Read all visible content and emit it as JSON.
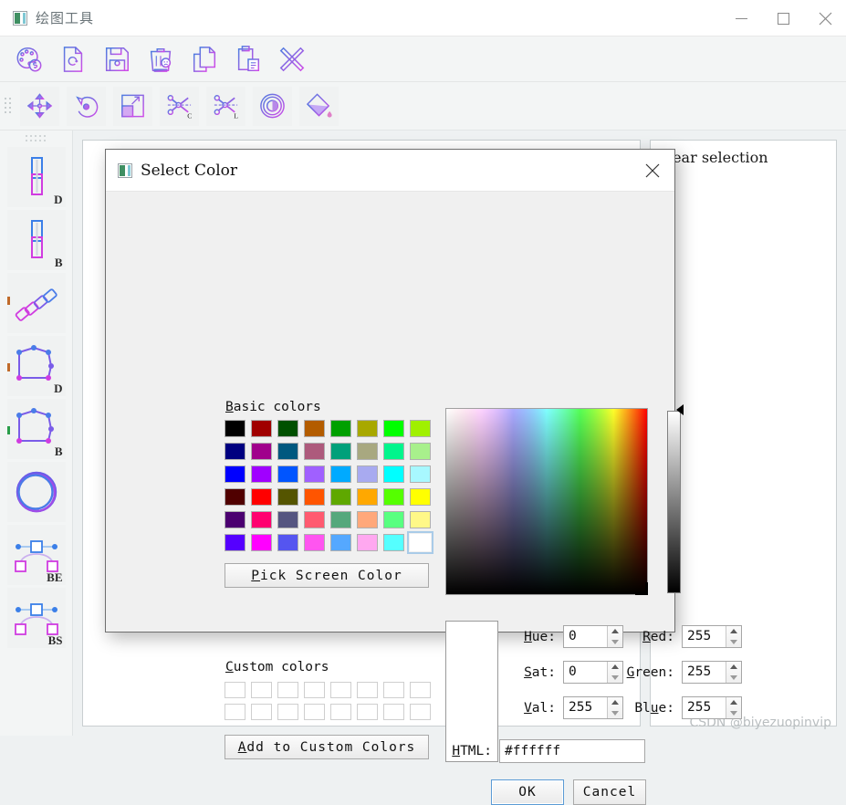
{
  "window": {
    "title": "绘图工具",
    "icon": "app-icon",
    "controls": {
      "minimize": "–",
      "maximize": "□",
      "close": "✕"
    }
  },
  "toolbar_primary": {
    "items": [
      {
        "name": "color-palette",
        "label": "Color Palette"
      },
      {
        "name": "new-document",
        "label": "New"
      },
      {
        "name": "save",
        "label": "Save"
      },
      {
        "name": "delete",
        "label": "Delete"
      },
      {
        "name": "copy",
        "label": "Copy"
      },
      {
        "name": "paste",
        "label": "Paste"
      },
      {
        "name": "close-cross",
        "label": "Close"
      }
    ]
  },
  "toolbar_secondary": {
    "items": [
      {
        "name": "move",
        "label": "Move"
      },
      {
        "name": "rotate",
        "label": "Rotate"
      },
      {
        "name": "scale",
        "label": "Scale"
      },
      {
        "name": "cut-c",
        "label": "Cut C",
        "badge": "C"
      },
      {
        "name": "cut-l",
        "label": "Cut L",
        "badge": "L"
      },
      {
        "name": "ring",
        "label": "Ring"
      },
      {
        "name": "fill-bucket",
        "label": "Fill"
      }
    ]
  },
  "sidebar": {
    "items": [
      {
        "name": "line-d",
        "badge": "D",
        "edge_color": ""
      },
      {
        "name": "line-b",
        "badge": "B",
        "edge_color": ""
      },
      {
        "name": "dashed-chain",
        "badge": "",
        "edge_color": "#c06a2a"
      },
      {
        "name": "polygon-d",
        "badge": "D",
        "edge_color": "#c06a2a"
      },
      {
        "name": "polygon-b",
        "badge": "B",
        "edge_color": "#2a9d4a"
      },
      {
        "name": "circle",
        "badge": "",
        "edge_color": ""
      },
      {
        "name": "bezier-be",
        "badge": "BE",
        "edge_color": ""
      },
      {
        "name": "bspline-bs",
        "badge": "BS",
        "edge_color": ""
      }
    ]
  },
  "right_panel": {
    "label": "clear selection"
  },
  "watermark": {
    "text": "CSDN @biyezuopinvip"
  },
  "dialog": {
    "title": "Select Color",
    "close_label": "✕",
    "basic_colors_label": "Basic colors",
    "basic_colors": [
      [
        "#000000",
        "#a00000",
        "#005000",
        "#b35c00",
        "#00a000",
        "#a8a800",
        "#00ff00",
        "#a0f000"
      ],
      [
        "#000080",
        "#a0008c",
        "#00587f",
        "#ad5a7c",
        "#00a07a",
        "#a8a880",
        "#00f58c",
        "#a8f08c"
      ],
      [
        "#0000ff",
        "#a000ff",
        "#0055ff",
        "#a060ff",
        "#00aaff",
        "#a8aaf0",
        "#00ffff",
        "#a8f8ff"
      ],
      [
        "#500000",
        "#ff0000",
        "#555500",
        "#ff5500",
        "#5fa800",
        "#ffa800",
        "#55ff00",
        "#ffff00"
      ],
      [
        "#4b0070",
        "#ff0070",
        "#555580",
        "#ff5a70",
        "#55a87c",
        "#ffa87a",
        "#58ff80",
        "#fff888"
      ],
      [
        "#5500ff",
        "#ff00ff",
        "#5555f0",
        "#ff55f0",
        "#55a8ff",
        "#ffa8f0",
        "#55ffff",
        "#ffffff"
      ]
    ],
    "basic_selected": {
      "row": 5,
      "col": 7
    },
    "pick_screen_label": "Pick Screen Color",
    "custom_colors_label": "Custom colors",
    "custom_colors": [
      [
        "#ffffff",
        "#ffffff",
        "#ffffff",
        "#ffffff",
        "#ffffff",
        "#ffffff",
        "#ffffff",
        "#ffffff"
      ],
      [
        "#ffffff",
        "#ffffff",
        "#ffffff",
        "#ffffff",
        "#ffffff",
        "#ffffff",
        "#ffffff",
        "#ffffff"
      ]
    ],
    "add_custom_label": "Add to Custom Colors",
    "preview_color": "#ffffff",
    "fields": {
      "hue": {
        "label": "Hue:",
        "value": "0"
      },
      "sat": {
        "label": "Sat:",
        "value": "0"
      },
      "val": {
        "label": "Val:",
        "value": "255"
      },
      "red": {
        "label": "Red:",
        "value": "255"
      },
      "green": {
        "label": "Green:",
        "value": "255"
      },
      "blue": {
        "label": "Blue:",
        "value": "255"
      },
      "html": {
        "label": "HTML:",
        "value": "#ffffff"
      }
    },
    "buttons": {
      "ok": "OK",
      "cancel": "Cancel"
    }
  }
}
